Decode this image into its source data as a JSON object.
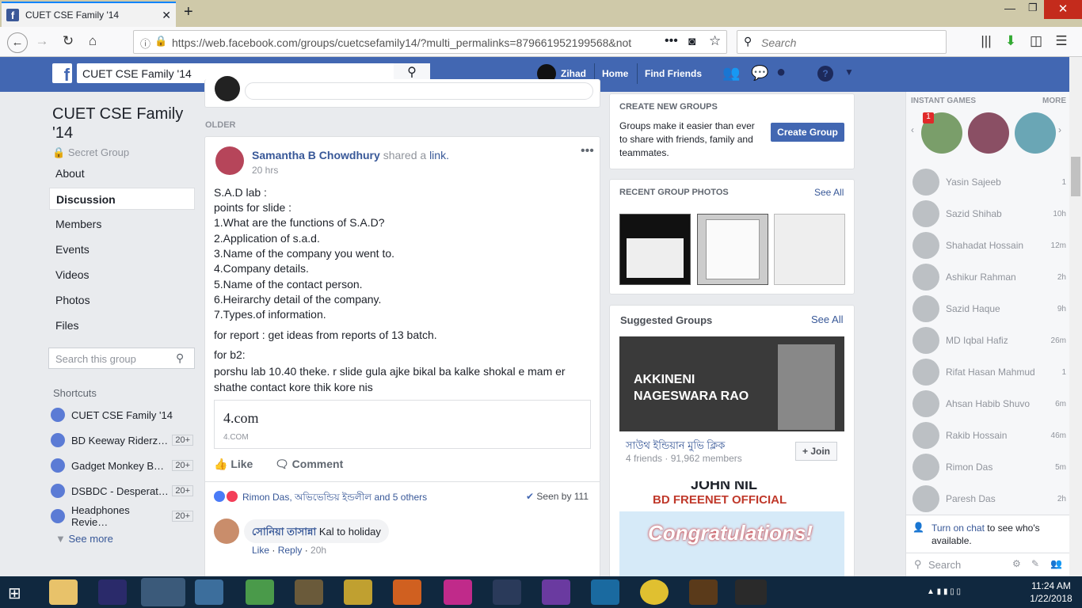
{
  "browser": {
    "tab_title": "CUET CSE Family '14",
    "url": "https://web.facebook.com/groups/cuetcsefamily14/?multi_permalinks=879661952199568&not",
    "search_placeholder": "Search"
  },
  "fb": {
    "search_value": "CUET CSE Family '14",
    "user": "Zihad",
    "home": "Home",
    "find_friends": "Find Friends"
  },
  "group": {
    "title": "CUET CSE Family '14",
    "privacy": "Secret Group",
    "nav": [
      "About",
      "Discussion",
      "Members",
      "Events",
      "Videos",
      "Photos",
      "Files"
    ],
    "search_placeholder": "Search this group",
    "shortcuts_label": "Shortcuts",
    "shortcuts": [
      {
        "name": "CUET CSE Family '14",
        "badge": ""
      },
      {
        "name": "BD Keeway Riderz…",
        "badge": "20+"
      },
      {
        "name": "Gadget Monkey B…",
        "badge": "20+"
      },
      {
        "name": "DSBDC - Desperat…",
        "badge": "20+"
      },
      {
        "name": "Headphones Revie…",
        "badge": "20+"
      }
    ],
    "see_more": "See more"
  },
  "feed": {
    "older_label": "OLDER",
    "post": {
      "author": "Samantha B Chowdhury",
      "action": "shared a",
      "action_link": "link.",
      "time": "20 hrs",
      "lines": [
        "S.A.D lab :",
        "points for slide :",
        "1.What are the functions of S.A.D?",
        "2.Application of s.a.d.",
        "3.Name of the company you went to.",
        "4.Company details.",
        "5.Name of the contact person.",
        "6.Heirarchy detail of the company.",
        "7.Types.of information."
      ],
      "report": "for report : get ideas from reports of 13 batch.",
      "b2_label": "for b2:",
      "b2_text": "porshu lab 10.40 theke. r slide gula ajke bikal ba kalke shokal e mam er shathe contact kore thik kore nis",
      "link_title": "4.com",
      "link_domain": "4.COM",
      "like": "Like",
      "comment": "Comment",
      "reactors": "Rimon Das, অভিভেন্ডিয় ইন্ডলীল and 5 others",
      "seen_by": "Seen by 111",
      "comment_author": "সোনিয়া তাসান্না",
      "comment_text": "Kal to holiday",
      "comment_like": "Like",
      "comment_reply": "Reply",
      "comment_time": "20h"
    }
  },
  "right": {
    "create_header": "CREATE NEW GROUPS",
    "create_text": "Groups make it easier than ever to share with friends, family and teammates.",
    "create_button": "Create Group",
    "photos_header": "RECENT GROUP PHOTOS",
    "see_all": "See All",
    "suggested_header": "Suggested Groups",
    "sg1_banner": "AKKINENI NAGESWARA RAO",
    "sg1_name": "সাউথ ইন্ডিয়ান মুভি ক্লিক",
    "sg1_meta": "4 friends · 91,962 members",
    "join": "+ Join",
    "sg2_banner_a": "JOHN NIL",
    "sg2_banner_b": "BD FREENET OFFICIAL",
    "sg2_banner_c": "Congratulations!"
  },
  "chat": {
    "games_header": "INSTANT GAMES",
    "more": "MORE",
    "game_badge": "1",
    "contacts": [
      {
        "name": "Yasin Sajeeb",
        "meta": "1"
      },
      {
        "name": "Sazid Shihab",
        "meta": "10h"
      },
      {
        "name": "Shahadat Hossain",
        "meta": "12m"
      },
      {
        "name": "Ashikur Rahman",
        "meta": "2h"
      },
      {
        "name": "Sazid Haque",
        "meta": "9h"
      },
      {
        "name": "MD Iqbal Hafiz",
        "meta": "26m"
      },
      {
        "name": "Rifat Hasan Mahmud",
        "meta": "1"
      },
      {
        "name": "Ahsan Habib Shuvo",
        "meta": "6m"
      },
      {
        "name": "Rakib Hossain",
        "meta": "46m"
      },
      {
        "name": "Rimon Das",
        "meta": "5m"
      },
      {
        "name": "Paresh Das",
        "meta": "2h"
      }
    ],
    "turn_on": "Turn on chat",
    "turn_on_rest": "to see who's available.",
    "search_placeholder": "Search"
  },
  "taskbar": {
    "time": "11:24 AM",
    "date": "1/22/2018"
  },
  "colors": {
    "fb_blue": "#4267b2",
    "link": "#385898",
    "taskbar": "#10283f"
  }
}
